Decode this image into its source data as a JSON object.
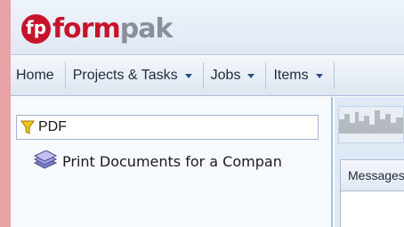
{
  "app": {
    "logo_form": "form",
    "logo_pak": "pak",
    "logo_mark_letter": "fp",
    "brand_color": "#c8142a",
    "brand_secondary_color": "#8a8f99"
  },
  "navbar": {
    "items": [
      {
        "label": "Home",
        "dropdown": false
      },
      {
        "label": "Projects & Tasks",
        "dropdown": true
      },
      {
        "label": "Jobs",
        "dropdown": true
      },
      {
        "label": "Items",
        "dropdown": true
      }
    ]
  },
  "left_panel": {
    "filter": {
      "value": "PDF",
      "icon": "filter-funnel-icon"
    },
    "tree": [
      {
        "label": "Print Documents for a Compan",
        "icon": "document-stack-icon"
      }
    ]
  },
  "right_panel": {
    "tab_label": "Messages"
  }
}
